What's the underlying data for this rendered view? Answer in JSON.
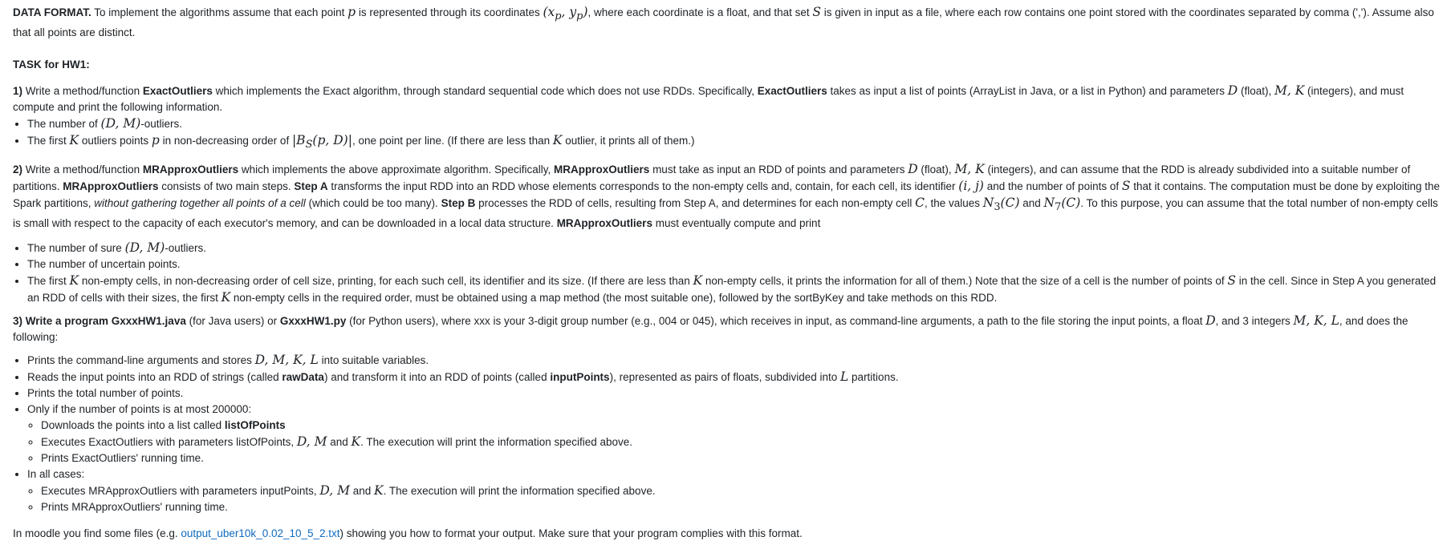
{
  "data_format": {
    "label": "DATA FORMAT.",
    "t1": " To implement the algorithms assume that each point ",
    "m_p": "p",
    "t2": " is represented through its coordinates ",
    "m_coords": "(x",
    "t3": ", where each coordinate is a float, and that set ",
    "m_S": "S",
    "t4": " is given in input as a file, where each row contains one point stored with the coordinates separated by comma (','). Assume also that all points are distinct."
  },
  "task_heading": "TASK for HW1:",
  "sec1": {
    "num": "1)",
    "t1": " Write a method/function ",
    "name1": "ExactOutliers",
    "t2": " which implements the Exact algorithm, through standard sequential code which does not use RDDs.  Specifically, ",
    "name2": "ExactOutliers",
    "t3": " takes as input a list of points (ArrayList in Java, or a list in Python) and parameters ",
    "m_D": "D",
    "t4": " (float), ",
    "m_MK": "M, K",
    "t5": " (integers), and must compute and print the following information.",
    "b1_t1": "The number of ",
    "b1_m": "(D, M)",
    "b1_t2": "-outliers.",
    "b2_t1": "The first ",
    "b2_m1": "K",
    "b2_t2": " outliers points ",
    "b2_m2": "p",
    "b2_t3": " in non-decreasing order of ",
    "b2_m3": "|B",
    "b2_m3sub": "S",
    "b2_m3rest": "(p, D)|",
    "b2_t4": ", one point per line. (If there are less than ",
    "b2_m4": "K",
    "b2_t5": " outlier, it prints all of them.)"
  },
  "sec2": {
    "num": "2)",
    "t1": " Write a method/function ",
    "name1": "MRApproxOutliers",
    "t2": " which implements the above approximate algorithm. Specifically, ",
    "name2": "MRApproxOutliers",
    "t3": " must take as input an RDD of points and parameters ",
    "m_D": "D",
    "t4": " (float), ",
    "m_MK": "M, K",
    "t5": " (integers), and can assume that the RDD is already subdivided into a suitable number of partitions. ",
    "name3": "MRApproxOutliers",
    "t6": " consists of two main steps. ",
    "stepA": "Step A",
    "t7": " transforms the input RDD into an RDD whose elements corresponds to the non-empty cells and, contain, for each cell, its identifier ",
    "m_ij": "(i, j)",
    "t8": " and the number of points of ",
    "m_S": "S",
    "t9": " that it contains. The computation must be done by exploiting the Spark partitions, ",
    "italic": "without gathering together all points of a cell",
    "t10": " (which could be too many). ",
    "stepB": "Step B",
    "t11": " processes the RDD of cells, resulting from Step A, and determines for each non-empty cell ",
    "m_C": "C",
    "t12": ", the values ",
    "m_N3": "N",
    "m_N3sub": "3",
    "m_N3rest": "(C)",
    "t13": " and ",
    "m_N7": "N",
    "m_N7sub": "7",
    "m_N7rest": "(C)",
    "t14": ". To this purpose, you can assume that the total number of non-empty cells is small with respect to the capacity of each executor's memory, and can be downloaded in a local data structure. ",
    "name4": "MRApproxOutliers",
    "t15": " must eventually compute and print",
    "b1_t1": "The number of sure ",
    "b1_m": "(D, M)",
    "b1_t2": "-outliers.",
    "b2": "The number of uncertain points.",
    "b3_t1": "The first ",
    "b3_m1": "K",
    "b3_t2": " non-empty cells,  in non-decreasing order of cell size, printing, for each such cell, its identifier and its size. (If there are less than ",
    "b3_m2": "K",
    "b3_t3": " non-empty cells, it prints the information for all of them.) Note that the size of a cell is the number of points of ",
    "b3_m3": "S",
    "b3_t4": " in the cell. Since in Step A you generated an RDD of cells with their sizes, the first ",
    "b3_m4": "K",
    "b3_t5": " non-empty cells in the required order, must be obtained using a map method (the most suitable one), followed by the sortByKey and take methods on this RDD."
  },
  "sec3": {
    "bold1": "3) Write a program GxxxHW1.java",
    "t1": " (for Java users) or ",
    "bold2": "GxxxHW1.py",
    "t2": " (for Python users), where xxx is your 3-digit group number (e.g., 004 or 045), which receives in input, as command-line arguments, a path to the file storing the input points, a float ",
    "m_D": "D",
    "t3": ", and 3 integers ",
    "m_MKL": "M, K, L",
    "t4": ", and does the following:",
    "b1_t1": "Prints the command-line arguments and stores ",
    "b1_m": "D, M, K, L",
    "b1_t2": " into suitable variables.",
    "b2_t1": "Reads the input points into an RDD of strings (called ",
    "b2_bold1": "rawData",
    "b2_t2": ") and transform it into an RDD of points (called ",
    "b2_bold2": "inputPoints",
    "b2_t3": "), represented as pairs of floats, subdivided into ",
    "b2_m": "L",
    "b2_t4": " partitions.",
    "b3": "Prints the total number of points.",
    "b4": "Only if the number of points is at most 200000:",
    "b4_s1_t1": "Downloads the points into a list called ",
    "b4_s1_bold": "listOfPoints",
    "b4_s2_t1": "Executes ExactOutliers with parameters listOfPoints,  ",
    "b4_s2_m1": "D, M",
    "b4_s2_t2": " and ",
    "b4_s2_m2": "K",
    "b4_s2_t3": ". The execution will print the information specified above.",
    "b4_s3": "Prints ExactOutliers' running time.",
    "b5": "In all cases:",
    "b5_s1_t1": "Executes MRApproxOutliers with parameters inputPoints, ",
    "b5_s1_m1": "D, M",
    "b5_s1_t2": " and ",
    "b5_s1_m2": "K",
    "b5_s1_t3": ". The execution will print the information specified above.",
    "b5_s2": "Prints MRApproxOutliers' running time."
  },
  "footer": {
    "t1": "In moodle you find some files (e.g. ",
    "link": "output_uber10k_0.02_10_5_2.txt",
    "t2": ") showing you how to format your output. Make sure that your program complies with this format."
  }
}
